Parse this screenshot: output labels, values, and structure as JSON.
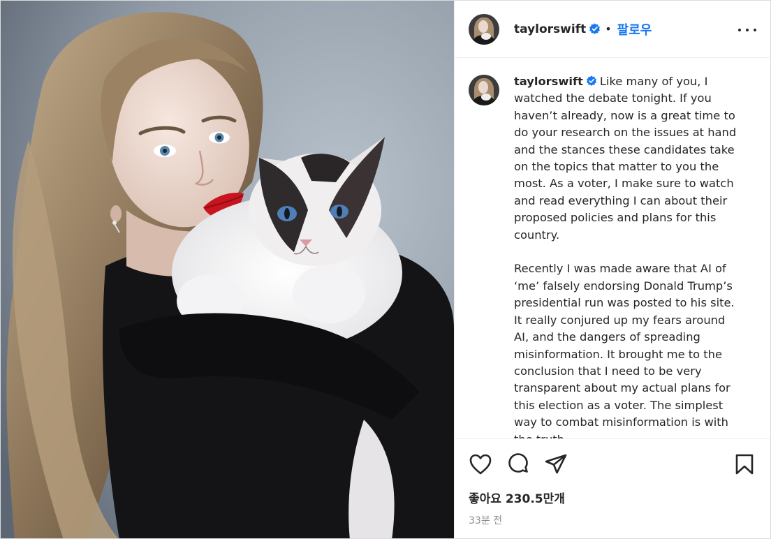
{
  "post": {
    "username": "taylorswift",
    "separator": "•",
    "follow_label": "팔로우",
    "more_icon": "more-options-icon",
    "verified_icon": "verified-badge-icon",
    "accent_color": "#1877f2"
  },
  "caption": {
    "username": "taylorswift",
    "text": "Like many of you, I watched the debate tonight. If you haven’t already, now is a great time to do your research on the issues at hand and the stances these candidates take on the topics that matter to you the most. As a voter, I make sure to watch and read everything I can about their proposed policies and plans for this country.\n\nRecently I was made aware that AI of ‘me’ falsely endorsing Donald Trump’s presidential run was posted to his site. It really conjured up my fears around AI, and the dangers of spreading misinformation. It brought me to the conclusion that I need to be very transparent about my actual plans for this election as a voter. The simplest way to combat misinformation is with the truth."
  },
  "actions": {
    "like_icon": "heart-icon",
    "comment_icon": "comment-icon",
    "share_icon": "share-icon",
    "save_icon": "bookmark-icon"
  },
  "stats": {
    "likes_label": "좋아요",
    "likes_count": "230.5만개",
    "timestamp": "33분 전"
  }
}
